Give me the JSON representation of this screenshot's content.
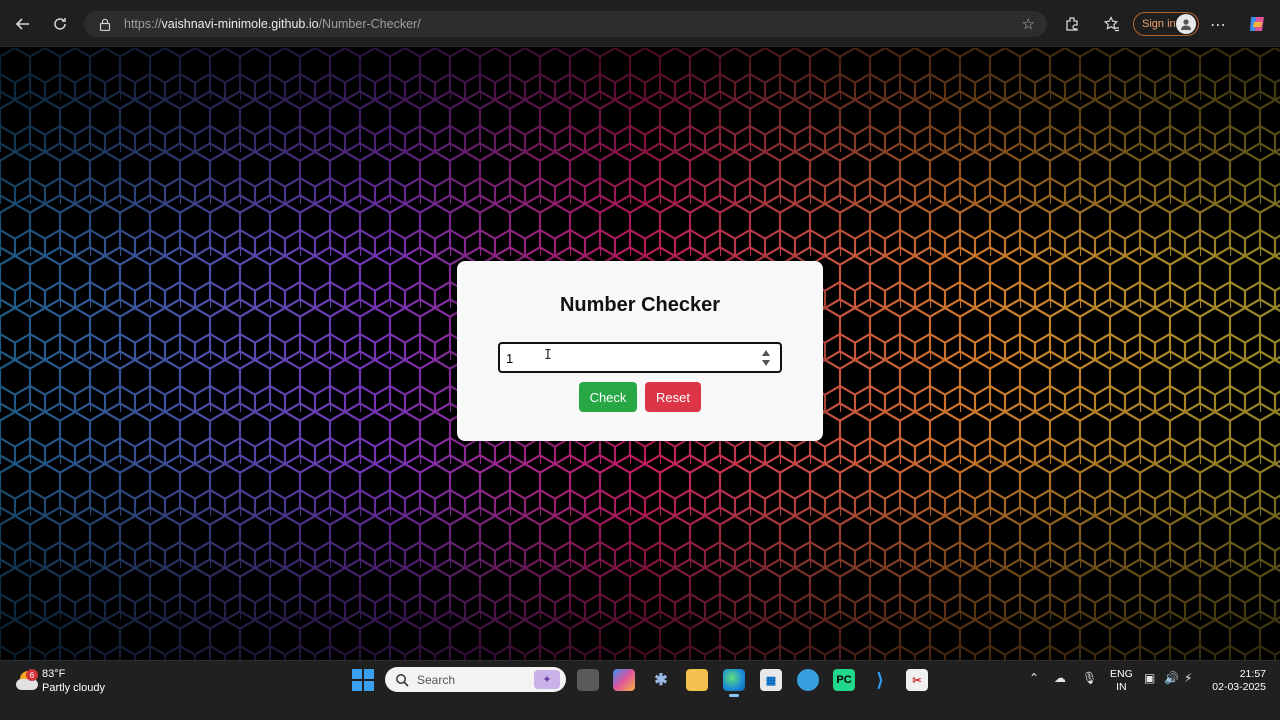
{
  "browser": {
    "url_prefix": "https://",
    "url_host": "vaishnavi-minimole.github.io",
    "url_path": "/Number-Checker/",
    "signin_label": "Sign in",
    "icons": [
      "back-icon",
      "reload-icon",
      "lock-icon",
      "star-icon",
      "extensions-icon",
      "favorites-icon",
      "avatar-icon",
      "more-icon",
      "copilot-icon"
    ]
  },
  "app": {
    "title": "Number Checker",
    "input_value": "1",
    "check_label": "Check",
    "reset_label": "Reset",
    "colors": {
      "check": "#28a745",
      "reset": "#dc3545",
      "card": "#f8f8f8"
    }
  },
  "taskbar": {
    "weather_temp": "83°F",
    "weather_desc": "Partly cloudy",
    "weather_badge": "6",
    "search_label": "Search",
    "lang_line1": "ENG",
    "lang_line2": "IN",
    "time": "21:57",
    "date": "02-03-2025"
  }
}
